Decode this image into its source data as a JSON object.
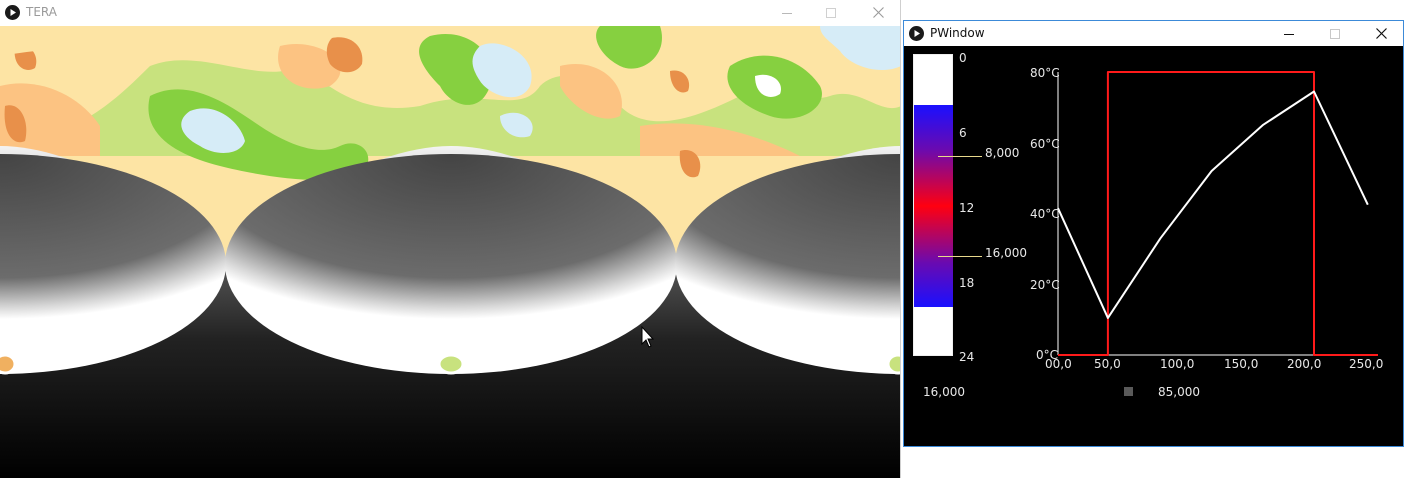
{
  "tera_window": {
    "title": "TERA",
    "controls": {
      "minimize": "minimize-icon",
      "maximize": "maximize-icon",
      "close": "close-icon"
    }
  },
  "pwindow": {
    "title": "PWindow",
    "controls": {
      "minimize": "minimize-icon",
      "maximize": "maximize-icon",
      "close": "close-icon"
    },
    "gradient_legend": {
      "ticks": [
        "0",
        "6",
        "12",
        "18",
        "24"
      ],
      "markers": [
        "8,000",
        "16,000"
      ],
      "below_value": "16,000"
    },
    "chart": {
      "y_ticks": [
        "80°C",
        "60°C",
        "40°C",
        "20°C",
        "0°C"
      ],
      "x_ticks": [
        "00,0",
        "50,0",
        "100,0",
        "150,0",
        "200,0",
        "250,0"
      ],
      "swatch_value": "85,000"
    }
  },
  "colors": {
    "map_white": "#ffffff",
    "map_light_blue": "#d6ecf7",
    "map_yellow": "#fde4a4",
    "map_peach": "#fcc382",
    "map_orange": "#e8904a",
    "map_lime": "#c8e27e",
    "map_green": "#86d040",
    "red_line": "#ff1a1a",
    "white_line": "#ffffff",
    "window_border": "#3c8ad8",
    "marker_line": "#e8d98c"
  },
  "chart_data": {
    "type": "line",
    "x_range": [
      0,
      250
    ],
    "y_range": [
      0,
      80
    ],
    "series": [
      {
        "color": "#ff1a1a",
        "x": [
          0,
          39,
          39,
          200,
          200,
          250
        ],
        "y": [
          0,
          0,
          80,
          80,
          0,
          0
        ]
      },
      {
        "color": "#ffffff",
        "x": [
          0,
          39,
          80,
          120,
          160,
          200,
          242
        ],
        "y": [
          41.5,
          10.5,
          33,
          52,
          65,
          74.5,
          42.5
        ]
      }
    ]
  }
}
